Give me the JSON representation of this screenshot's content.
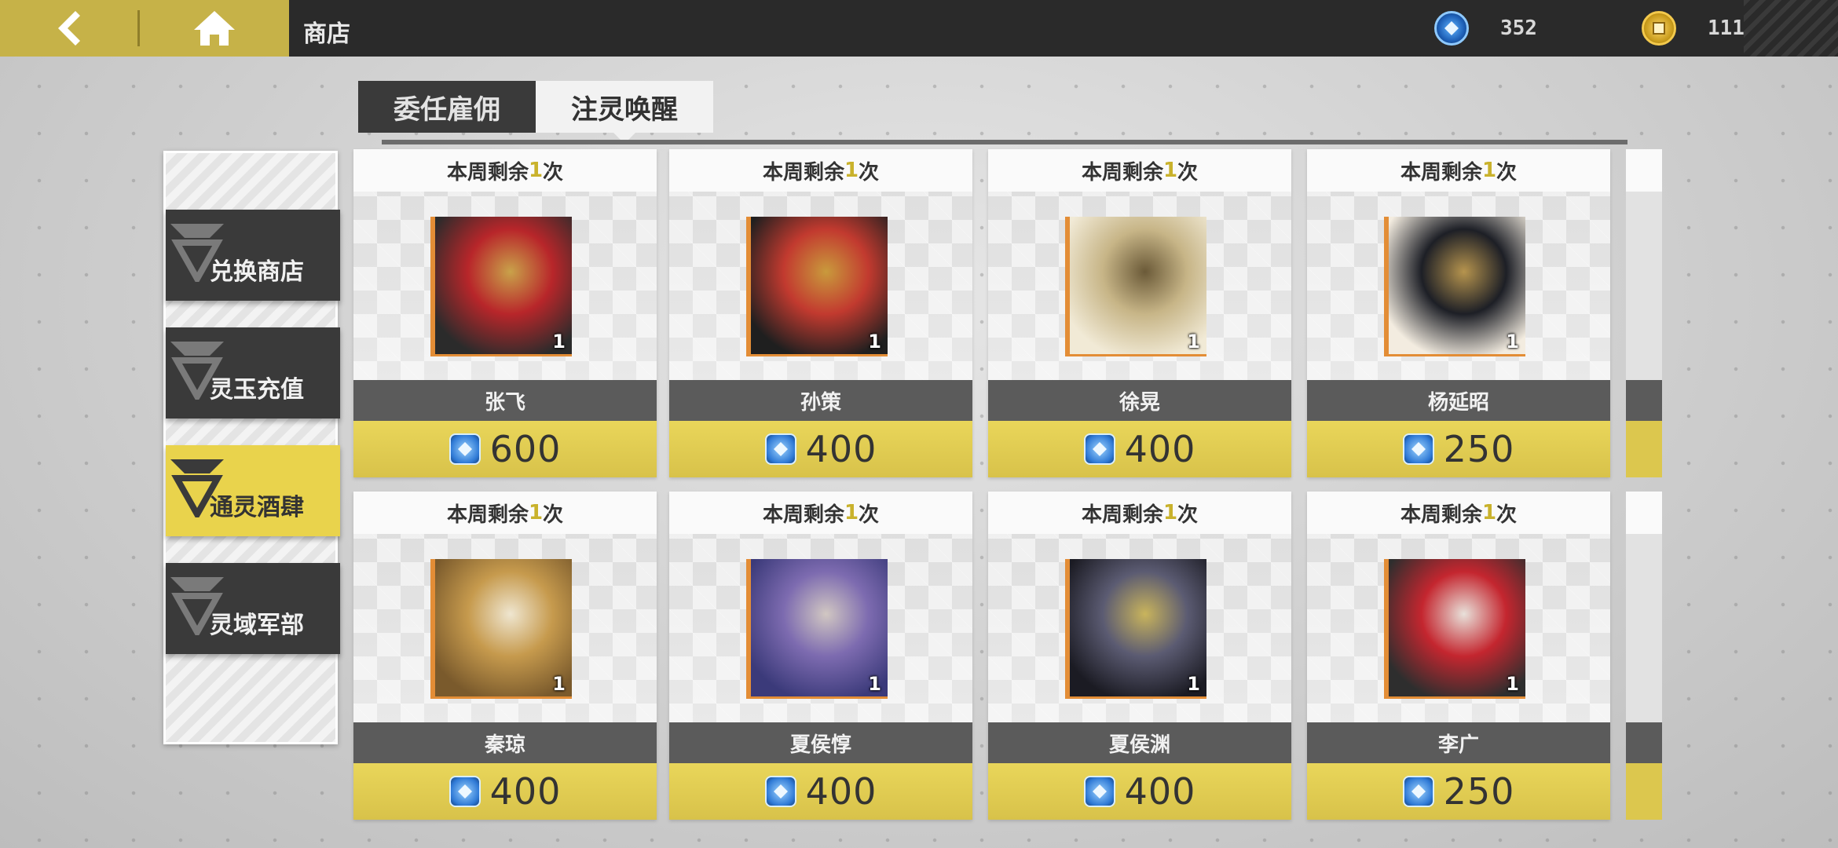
{
  "header": {
    "title": "商店",
    "currencies": [
      {
        "name": "jade",
        "icon": "jade-icon",
        "value": "352"
      },
      {
        "name": "coin",
        "icon": "coin-icon",
        "value": "111"
      }
    ]
  },
  "tabs": [
    {
      "label": "委任雇佣",
      "active": false
    },
    {
      "label": "注灵唤醒",
      "active": true
    }
  ],
  "sidebar": {
    "items": [
      {
        "label": "兑换商店",
        "active": false
      },
      {
        "label": "灵玉充值",
        "active": false
      },
      {
        "label": "通灵酒肆",
        "active": true
      },
      {
        "label": "灵域军部",
        "active": false
      }
    ]
  },
  "cards": [
    {
      "limit_prefix": "本周剩余",
      "limit_count": "1",
      "limit_suffix": "次",
      "name": "张飞",
      "quantity": "1",
      "price": "600",
      "colors": [
        "#2b2b2b",
        "#b8262a",
        "#c9a24a"
      ]
    },
    {
      "limit_prefix": "本周剩余",
      "limit_count": "1",
      "limit_suffix": "次",
      "name": "孙策",
      "quantity": "1",
      "price": "400",
      "colors": [
        "#1f1f1f",
        "#c23a2f",
        "#c99a3c"
      ]
    },
    {
      "limit_prefix": "本周剩余",
      "limit_count": "1",
      "limit_suffix": "次",
      "name": "徐晃",
      "quantity": "1",
      "price": "400",
      "colors": [
        "#f1ead6",
        "#c7b587",
        "#6b5a38"
      ]
    },
    {
      "limit_prefix": "本周剩余",
      "limit_count": "1",
      "limit_suffix": "次",
      "name": "杨延昭",
      "quantity": "1",
      "price": "250",
      "colors": [
        "#f3ece0",
        "#1d1f26",
        "#b6944e"
      ]
    },
    {
      "limit_prefix": "本周剩余",
      "limit_count": "1",
      "limit_suffix": "次",
      "name": "秦琼",
      "quantity": "1",
      "price": "400",
      "colors": [
        "#7a5a2c",
        "#c69a4d",
        "#efe6d0"
      ]
    },
    {
      "limit_prefix": "本周剩余",
      "limit_count": "1",
      "limit_suffix": "次",
      "name": "夏侯惇",
      "quantity": "1",
      "price": "400",
      "colors": [
        "#3b3a7a",
        "#7d6bb0",
        "#d1c7c2"
      ]
    },
    {
      "limit_prefix": "本周剩余",
      "limit_count": "1",
      "limit_suffix": "次",
      "name": "夏侯渊",
      "quantity": "1",
      "price": "400",
      "colors": [
        "#1b1b23",
        "#5b5b72",
        "#c9b45c"
      ]
    },
    {
      "limit_prefix": "本周剩余",
      "limit_count": "1",
      "limit_suffix": "次",
      "name": "李广",
      "quantity": "1",
      "price": "250",
      "colors": [
        "#2e2e2e",
        "#c4262f",
        "#e8e1da"
      ]
    }
  ]
}
